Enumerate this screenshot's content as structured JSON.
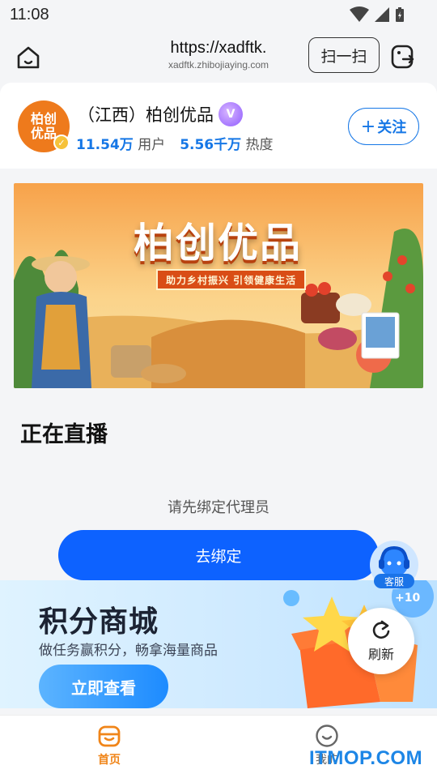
{
  "status_bar": {
    "time": "11:08"
  },
  "browser": {
    "url_main": "https://xadftk.",
    "url_sub": "xadftk.zhibojiaying.com",
    "scan_label": "扫一扫"
  },
  "profile": {
    "logo_text_line1": "柏创",
    "logo_text_line2": "优品",
    "shop_name": "（江西）柏创优品",
    "users_value": "11.54万",
    "users_label": "用户",
    "heat_value": "5.56千万",
    "heat_label": "热度",
    "follow_label": "关注"
  },
  "banner": {
    "title": "柏创优品",
    "subtitle": "助力乡村振兴  引领健康生活"
  },
  "live": {
    "section_title": "正在直播",
    "bind_hint": "请先绑定代理员",
    "bind_button": "去绑定"
  },
  "service": {
    "label": "客服"
  },
  "mall": {
    "title": "积分商城",
    "subtitle": "做任务赢积分，畅拿海量商品",
    "button": "立即查看",
    "bubble": "+10"
  },
  "refresh": {
    "label": "刷新"
  },
  "nav": {
    "home_label": "首页",
    "mine_label": "我的"
  },
  "watermark": "ITMOP.COM",
  "colors": {
    "accent_blue": "#0d62ff",
    "link_blue": "#1677e6",
    "home_orange": "#f08519"
  }
}
